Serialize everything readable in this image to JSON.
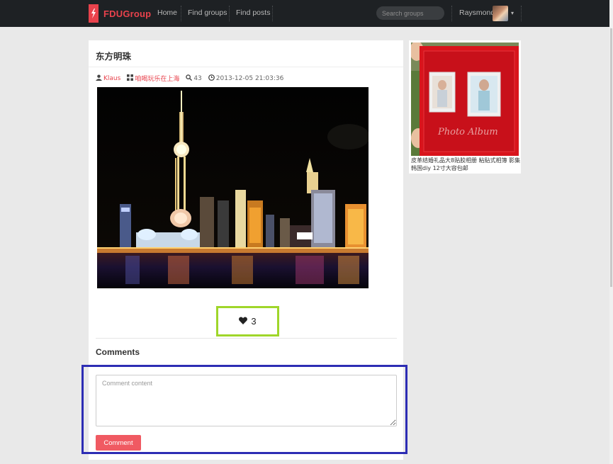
{
  "nav": {
    "brand": "FDUGroup",
    "links": [
      "Home",
      "Find groups",
      "Find posts"
    ],
    "search_placeholder": "Search groups",
    "user": "Raysmond",
    "caret": "▾"
  },
  "post": {
    "title": "东方明珠",
    "author": "Klaus",
    "group": "咱喝玩乐在上海",
    "views": "43",
    "date": "2013-12-05 21:03:36",
    "likes": "3",
    "comments_heading": "Comments",
    "comment_placeholder": "Comment content",
    "comment_button": "Comment"
  },
  "ad": {
    "caption": "皮革结婚礼品大8贴胶相册 粘贴式相簿 影集韩国diy 12寸大容包邮",
    "album_text": "Photo Album"
  },
  "colors": {
    "brand": "#e8424c",
    "like_outline": "#9fd62a",
    "comment_outline": "#2d2db4",
    "button": "#f05a62"
  },
  "icons": {
    "brand_logo": "brand-logo-icon",
    "user": "user-icon",
    "group": "group-icon",
    "views": "search-icon",
    "date": "clock-icon",
    "like": "heart-icon"
  }
}
